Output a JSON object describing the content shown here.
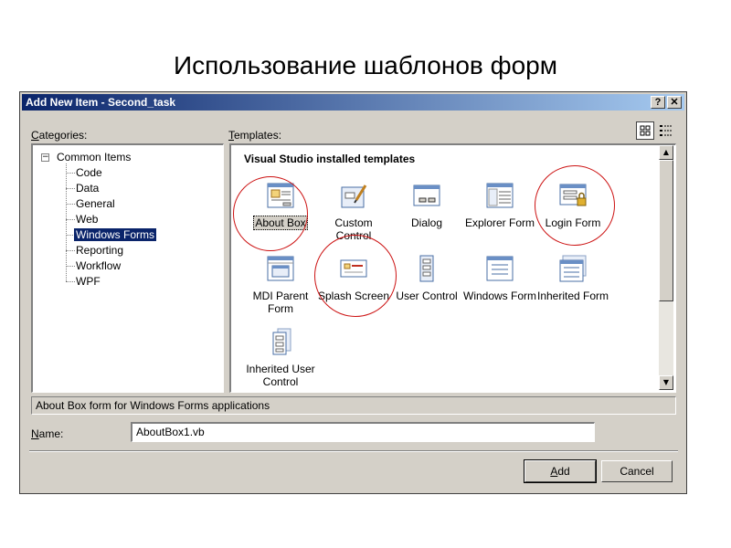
{
  "slide": {
    "title": "Использование шаблонов форм"
  },
  "dialog": {
    "title": "Add New Item - Second_task",
    "help_label": "?",
    "close_label": "✕",
    "categories_label": "Categories:",
    "templates_label": "Templates:",
    "categories": {
      "root": "Common Items",
      "root_expander": "−",
      "children": [
        "Code",
        "Data",
        "General",
        "Web",
        "Windows Forms",
        "Reporting",
        "Workflow",
        "WPF"
      ],
      "selected": "Windows Forms"
    },
    "templates_group": "Visual Studio installed templates",
    "templates": [
      {
        "name": "About Box",
        "icon": "about-box-icon"
      },
      {
        "name": "Custom Control",
        "icon": "custom-control-icon"
      },
      {
        "name": "Dialog",
        "icon": "dialog-icon"
      },
      {
        "name": "Explorer Form",
        "icon": "explorer-form-icon"
      },
      {
        "name": "Login Form",
        "icon": "login-form-icon"
      },
      {
        "name": "MDI Parent Form",
        "icon": "mdi-parent-form-icon"
      },
      {
        "name": "Splash Screen",
        "icon": "splash-screen-icon"
      },
      {
        "name": "User Control",
        "icon": "user-control-icon"
      },
      {
        "name": "Windows Form",
        "icon": "windows-form-icon"
      },
      {
        "name": "Inherited Form",
        "icon": "inherited-form-icon"
      },
      {
        "name": "Inherited User Control",
        "icon": "inherited-user-control-icon"
      }
    ],
    "selected_template": "About Box",
    "description": "About Box form for Windows Forms applications",
    "name_label": "Name:",
    "name_value": "AboutBox1.vb",
    "add_button": "Add",
    "cancel_button": "Cancel",
    "view_buttons": [
      "large-icons-view-icon",
      "small-icons-view-icon"
    ],
    "annotation_color": "#cc1111"
  }
}
